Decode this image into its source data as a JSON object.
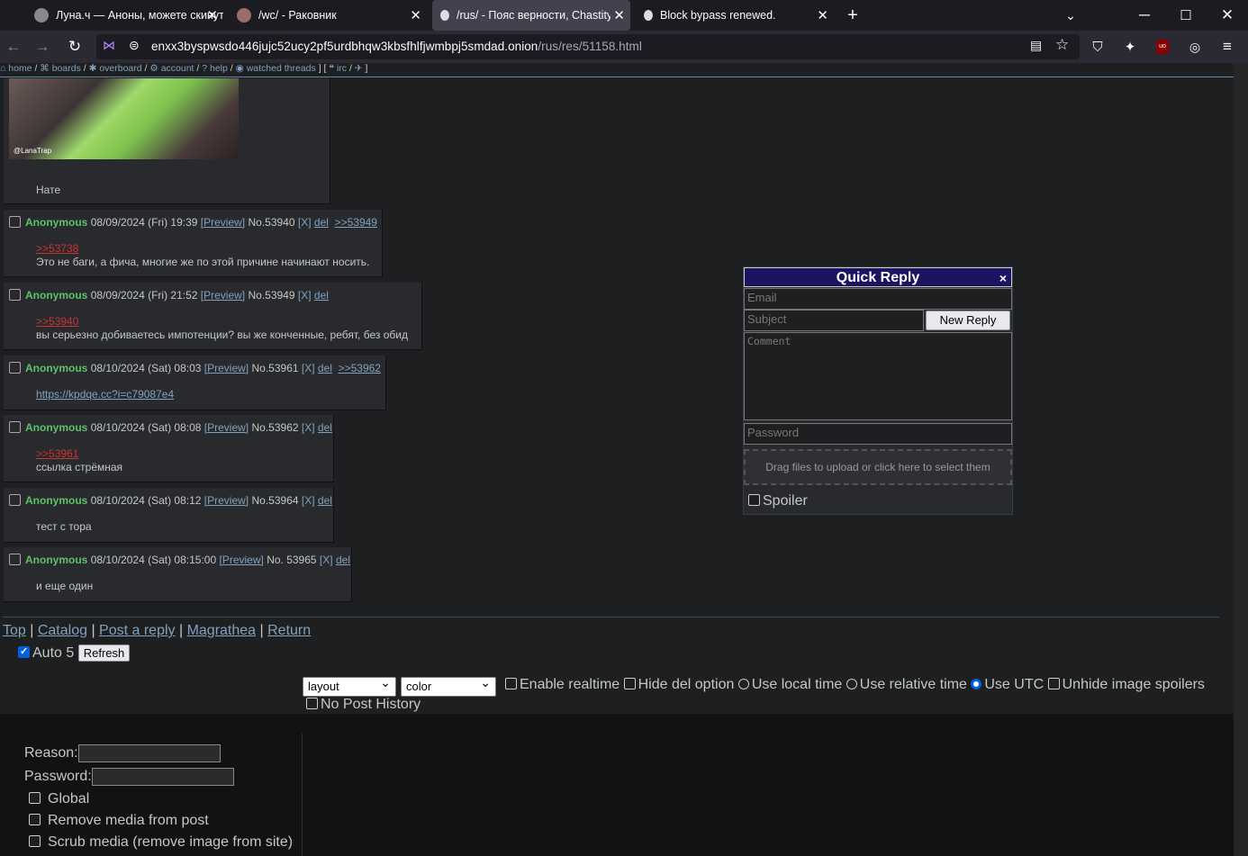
{
  "browser": {
    "tabs": [
      {
        "title": "Луна.ч — Аноны, можете скинуть",
        "active": false
      },
      {
        "title": "/wc/ - Раковник",
        "active": false
      },
      {
        "title": "/rus/ - Пояс верности, Chastity",
        "active": true
      },
      {
        "title": "Block bypass renewed.",
        "active": false
      }
    ],
    "url_host": "enxx3byspwsdo446jujc52ucy2pf5urdbhqw3kbsfhlfjwmbpj5smdad.onion",
    "url_path": "/rus/res/51158.html"
  },
  "boardnav": {
    "home": "home",
    "boards": "boards",
    "overboard": "overboard",
    "account": "account",
    "help": "help",
    "watched": "watched threads",
    "irc": "irc"
  },
  "top_post": {
    "text": "Нате",
    "image_watermark": "@LanaTrap"
  },
  "posts": [
    {
      "name": "Anonymous",
      "date": "08/09/2024 (Fri) 19:39",
      "preview": "[Preview]",
      "no": "No.53940",
      "x": "[X]",
      "del": "del",
      "backlink": ">>53949",
      "quote": ">>53738",
      "text": "Это не баги, а фича, многие же по этой причине начинают носить."
    },
    {
      "name": "Anonymous",
      "date": "08/09/2024 (Fri) 21:52",
      "preview": "[Preview]",
      "no": "No.53949",
      "x": "[X]",
      "del": "del",
      "backlink": "",
      "quote": ">>53940",
      "text": "вы серьезно добиваетесь импотенции? вы же конченные, ребят, без обид"
    },
    {
      "name": "Anonymous",
      "date": "08/10/2024 (Sat) 08:03",
      "preview": "[Preview]",
      "no": "No.53961",
      "x": "[X]",
      "del": "del",
      "backlink": ">>53962",
      "quote": "",
      "text": "https://kpdqe.cc?i=c79087e4"
    },
    {
      "name": "Anonymous",
      "date": "08/10/2024 (Sat) 08:08",
      "preview": "[Preview]",
      "no": "No.53962",
      "x": "[X]",
      "del": "del",
      "backlink": "",
      "quote": ">>53961",
      "text": "ссылка стрёмная"
    },
    {
      "name": "Anonymous",
      "date": "08/10/2024 (Sat) 08:12",
      "preview": "[Preview]",
      "no": "No.53964",
      "x": "[X]",
      "del": "del",
      "backlink": "",
      "quote": "",
      "text": "тест с тора"
    },
    {
      "name": "Anonymous",
      "date": "08/10/2024 (Sat) 08:15:00",
      "preview": "[Preview]",
      "no": "No. 53965",
      "x": "[X]",
      "del": "del",
      "backlink": "",
      "quote": "",
      "text": "и еще один"
    }
  ],
  "quick_reply": {
    "title": "Quick Reply",
    "close": "×",
    "email_placeholder": "Email",
    "subject_placeholder": "Subject",
    "submit": "New Reply",
    "comment_placeholder": "Comment",
    "password_placeholder": "Password",
    "drop_text": "Drag files to upload or click here to select them",
    "spoiler": "Spoiler"
  },
  "footer": {
    "top": "Top",
    "catalog": "Catalog",
    "post_reply": "Post a reply",
    "magrathea": "Magrathea",
    "return": "Return",
    "auto_label": "Auto 5",
    "refresh": "Refresh"
  },
  "settings": {
    "layout": "layout",
    "color": "color",
    "enable_realtime": "Enable realtime",
    "hide_del": "Hide del option",
    "local_time": "Use local time",
    "relative_time": "Use relative time",
    "utc": "Use UTC",
    "unhide_spoilers": "Unhide image spoilers",
    "no_history": "No Post History"
  },
  "delete_form": {
    "reason": "Reason:",
    "password": "Password:",
    "global": "Global",
    "remove_media": "Remove media from post",
    "scrub_media": "Scrub media (remove image from site)"
  }
}
